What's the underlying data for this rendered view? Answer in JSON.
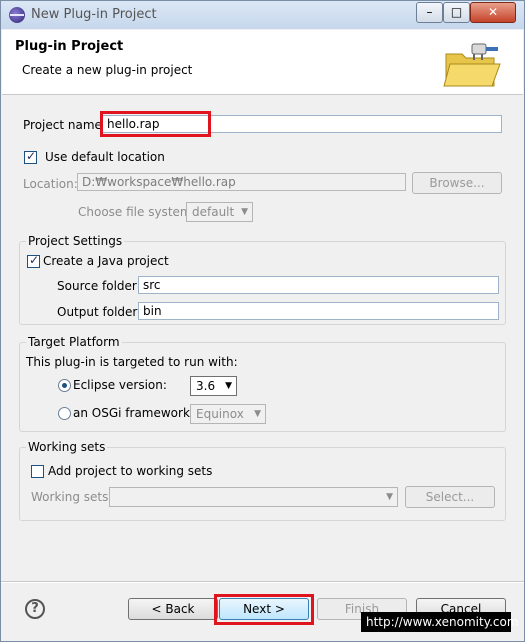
{
  "window": {
    "title": "New Plug-in Project",
    "minimize_glyph": "–",
    "maximize_glyph": "□",
    "close_glyph": "✕"
  },
  "header": {
    "title": "Plug-in Project",
    "description": "Create a new plug-in project",
    "icon": "plugin-folder-icon"
  },
  "project": {
    "name_label": "Project name:",
    "name_value": "hello.rap",
    "use_default_label": "Use default location",
    "use_default_checked": true,
    "location_label": "Location:",
    "location_value": "D:₩workspace₩hello.rap",
    "browse_label": "Browse...",
    "file_system_label": "Choose file system:",
    "file_system_value": "default"
  },
  "project_settings": {
    "title": "Project Settings",
    "create_java_label": "Create a Java project",
    "create_java_checked": true,
    "source_label": "Source folder:",
    "source_value": "src",
    "output_label": "Output folder:",
    "output_value": "bin"
  },
  "target_platform": {
    "title": "Target Platform",
    "intro": "This plug-in is targeted to run with:",
    "eclipse_label": "Eclipse version:",
    "eclipse_value": "3.6",
    "osgi_label": "an OSGi framework:",
    "osgi_value": "Equinox",
    "selected": "eclipse"
  },
  "working_sets": {
    "title": "Working sets",
    "add_label": "Add project to working sets",
    "add_checked": false,
    "sets_label": "Working sets:",
    "sets_value": "",
    "select_label": "Select..."
  },
  "footer": {
    "back_label": "< Back",
    "next_label": "Next >",
    "finish_label": "Finish",
    "cancel_label": "Cancel",
    "help_glyph": "?"
  },
  "watermark": "http://www.xenomity.com",
  "colors": {
    "highlight": "#e0141e"
  }
}
